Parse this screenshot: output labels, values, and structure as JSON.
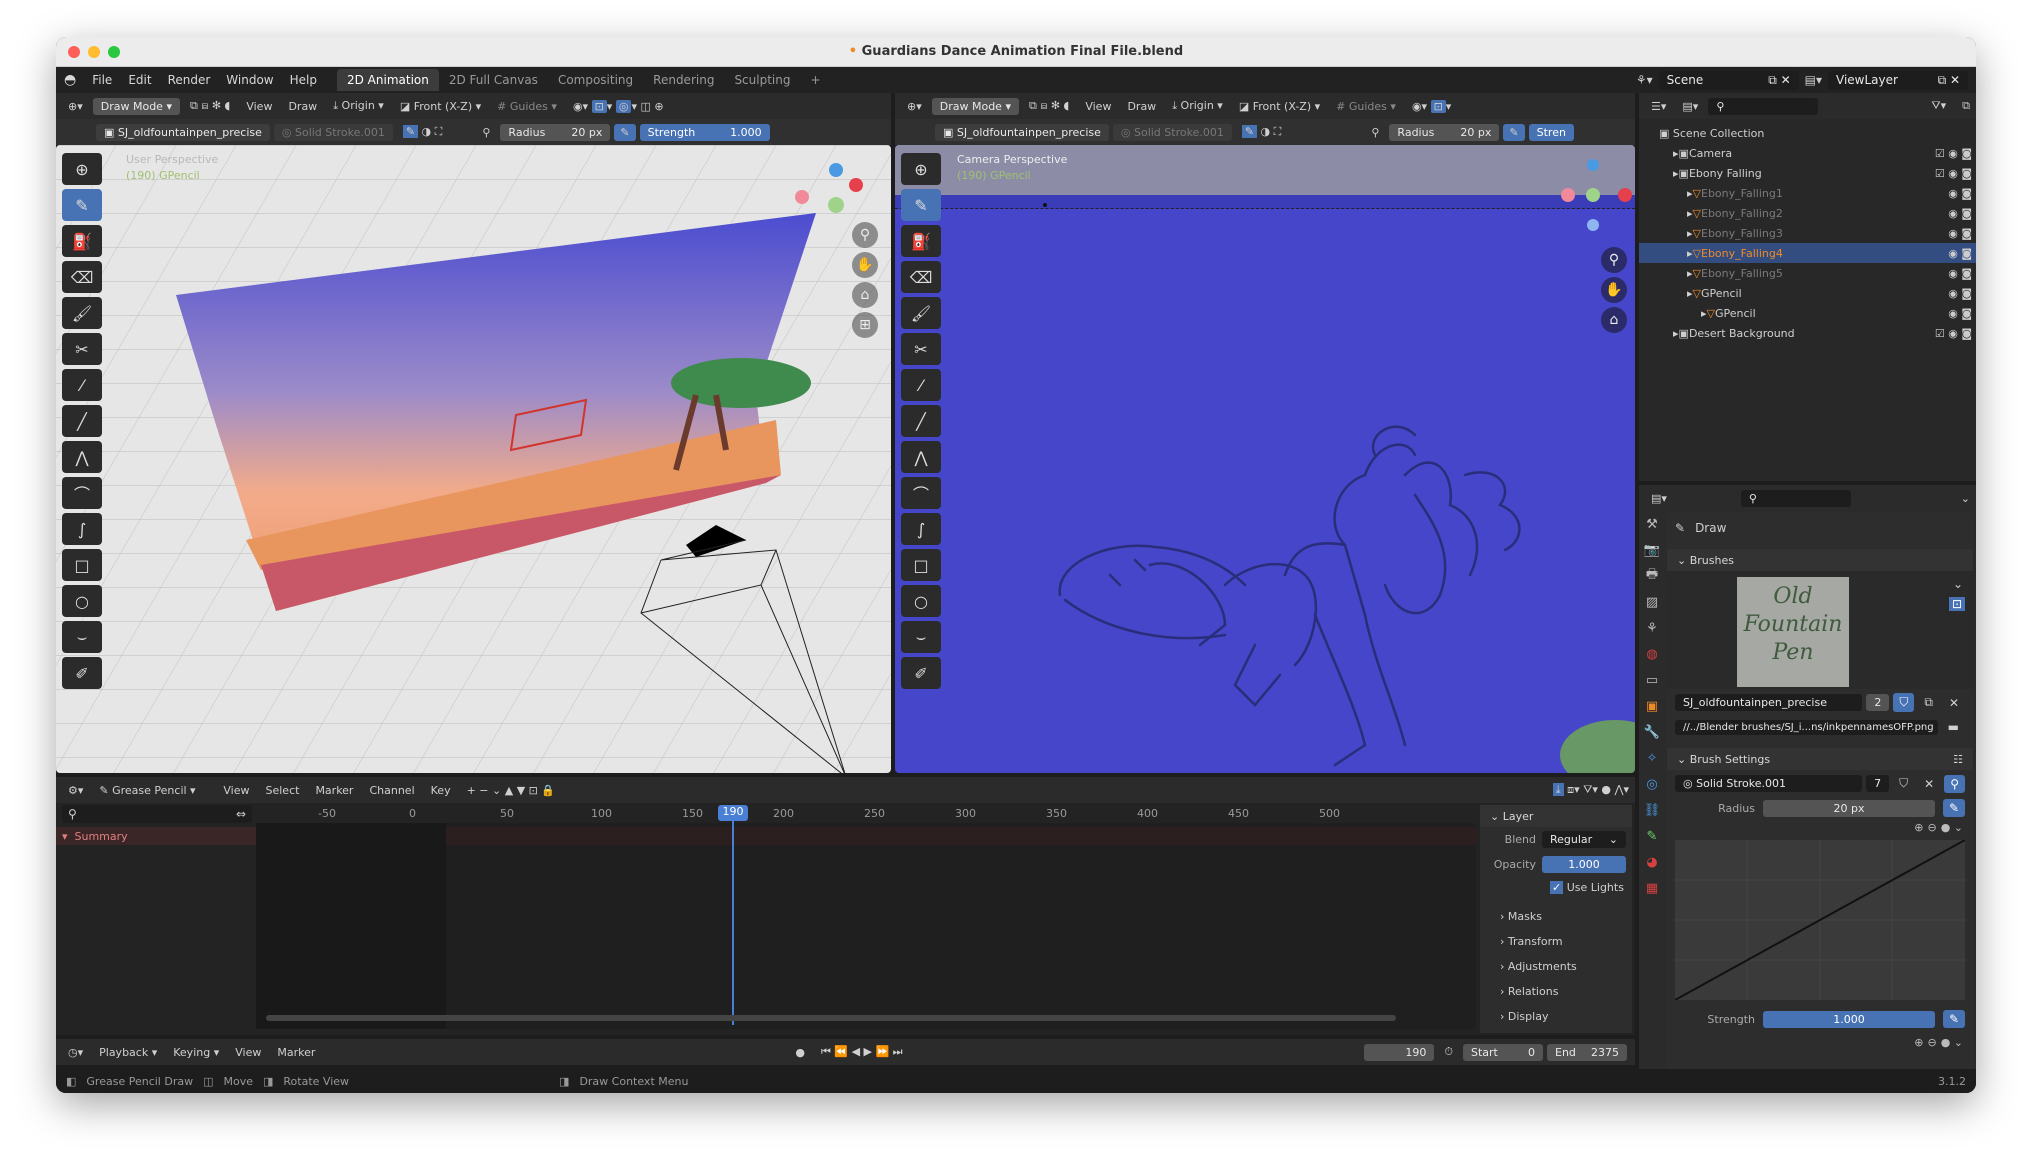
{
  "window": {
    "title": "Guardians Dance Animation Final File.blend"
  },
  "menu": [
    "File",
    "Edit",
    "Render",
    "Window",
    "Help"
  ],
  "workspaces": [
    {
      "label": "2D Animation",
      "active": true
    },
    {
      "label": "2D Full Canvas",
      "active": false
    },
    {
      "label": "Compositing",
      "active": false
    },
    {
      "label": "Rendering",
      "active": false
    },
    {
      "label": "Sculpting",
      "active": false
    }
  ],
  "add_workspace": "+",
  "scene": {
    "label": "Scene",
    "view_layer": "ViewLayer"
  },
  "viewport_header": {
    "mode": "Draw Mode",
    "view": "View",
    "draw": "Draw",
    "origin": "Origin",
    "orientation": "Front (X-Z)",
    "guides": "Guides"
  },
  "tool_settings": {
    "brush": "SJ_oldfountainpen_precise",
    "material": "Solid Stroke.001",
    "radius_label": "Radius",
    "radius_value": "20 px",
    "strength_label": "Strength",
    "strength_value": "1.000",
    "strength_short": "Stren"
  },
  "left_viewport": {
    "title": "User Perspective",
    "subtitle": "(190) GPencil"
  },
  "right_viewport": {
    "title": "Camera Perspective",
    "subtitle": "(190) GPencil"
  },
  "outliner": {
    "root": "Scene Collection",
    "items": [
      {
        "name": "Camera",
        "depth": 1,
        "selected": false,
        "dim": false
      },
      {
        "name": "Ebony Falling",
        "depth": 1,
        "selected": false,
        "dim": false
      },
      {
        "name": "Ebony_Falling1",
        "depth": 2,
        "selected": false,
        "dim": true
      },
      {
        "name": "Ebony_Falling2",
        "depth": 2,
        "selected": false,
        "dim": true
      },
      {
        "name": "Ebony_Falling3",
        "depth": 2,
        "selected": false,
        "dim": true
      },
      {
        "name": "Ebony_Falling4",
        "depth": 2,
        "selected": true,
        "dim": false
      },
      {
        "name": "Ebony_Falling5",
        "depth": 2,
        "selected": false,
        "dim": true
      },
      {
        "name": "GPencil",
        "depth": 2,
        "selected": false,
        "dim": false
      },
      {
        "name": "GPencil",
        "depth": 3,
        "selected": false,
        "dim": false
      },
      {
        "name": "Desert Background",
        "depth": 1,
        "selected": false,
        "dim": false
      }
    ]
  },
  "properties": {
    "tool_name": "Draw",
    "brushes_label": "Brushes",
    "brush_preview_text": "Old Fountain Pen",
    "brush_name": "SJ_oldfountainpen_precise",
    "brush_users": "2",
    "brush_path": "//../Blender brushes/SJ_i...ns/inkpennamesOFP.png",
    "brush_settings_label": "Brush Settings",
    "material": "Solid Stroke.001",
    "material_users": "7",
    "radius_label": "Radius",
    "radius_value": "20 px",
    "strength_label": "Strength",
    "strength_value": "1.000"
  },
  "dopesheet": {
    "mode": "Grease Pencil",
    "menus": [
      "View",
      "Select",
      "Marker",
      "Channel",
      "Key"
    ],
    "summary": "Summary",
    "ruler": [
      "-50",
      "0",
      "50",
      "100",
      "150",
      "200",
      "250",
      "300",
      "350",
      "400",
      "450",
      "500"
    ],
    "current_frame": "190"
  },
  "layer_panel": {
    "title": "Layer",
    "blend_label": "Blend",
    "blend_value": "Regular",
    "opacity_label": "Opacity",
    "opacity_value": "1.000",
    "use_lights": "Use Lights",
    "sections": [
      "Masks",
      "Transform",
      "Adjustments",
      "Relations",
      "Display"
    ]
  },
  "timeline": {
    "menus": [
      "Playback",
      "Keying",
      "View",
      "Marker"
    ],
    "frame": "190",
    "start_label": "Start",
    "start_value": "0",
    "end_label": "End",
    "end_value": "2375"
  },
  "statusbar": {
    "items": [
      "Grease Pencil Draw",
      "Move",
      "Rotate View",
      "Draw Context Menu"
    ],
    "version": "3.1.2"
  },
  "colors": {
    "accent": "#4772b3",
    "selection_orange": "#f08a24",
    "canvas_blue": "#4546c9",
    "ui_bg": "#1d1d1d"
  }
}
